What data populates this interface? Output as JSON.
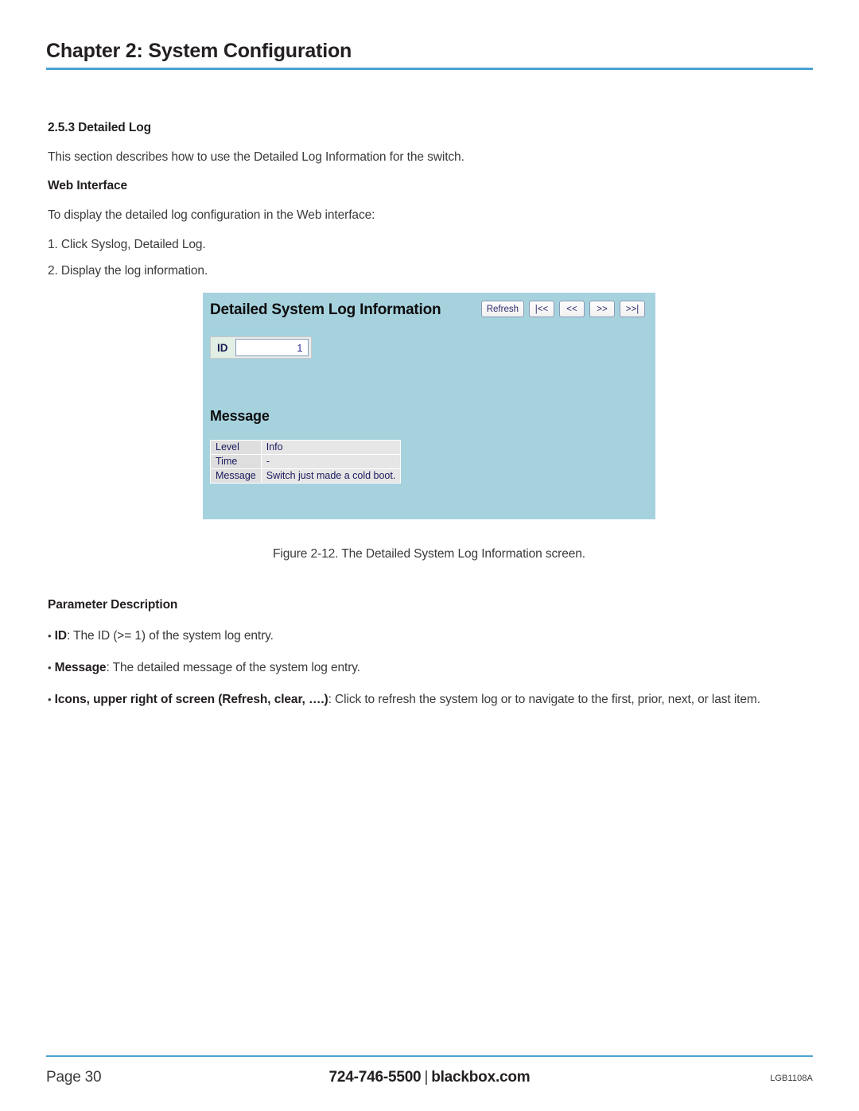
{
  "header": {
    "chapter_title": "Chapter 2: System Configuration",
    "rule_color": "#4ba3d3"
  },
  "body": {
    "section_number_title": "2.5.3 Detailed Log",
    "intro": "This section describes how to use the Detailed Log Information for the switch.",
    "web_interface_heading": "Web Interface",
    "web_interface_intro": "To display the detailed log configuration in the Web interface:",
    "step1": "1. Click Syslog, Detailed Log.",
    "step2": "2. Display the log information."
  },
  "figure": {
    "caption": "Figure 2-12. The Detailed System Log Information screen.",
    "panel_bg": "#a6d2de",
    "ui": {
      "title": "Detailed System Log Information",
      "buttons": [
        {
          "name": "refresh",
          "label": "Refresh"
        },
        {
          "name": "first",
          "label": "|<<"
        },
        {
          "name": "prev",
          "label": "<<"
        },
        {
          "name": "next",
          "label": ">>"
        },
        {
          "name": "last",
          "label": ">>|"
        }
      ],
      "id_label": "ID",
      "id_value": "1",
      "message_heading": "Message",
      "table": [
        {
          "key": "Level",
          "value": "Info"
        },
        {
          "key": "Time",
          "value": "-"
        },
        {
          "key": "Message",
          "value": "Switch just made a cold boot."
        }
      ]
    }
  },
  "params": {
    "heading": "Parameter Description",
    "bullets": [
      {
        "dot": "•",
        "label": "ID",
        "text": ": The ID (>= 1) of the system log entry."
      },
      {
        "dot": "•",
        "label": "Message",
        "text": ": The detailed message of the system log entry."
      },
      {
        "dot": "•",
        "label": "Icons, upper right of screen (Refresh, clear, ….)",
        "text": ": Click to refresh the system log or to navigate to the first, prior, next, or last item."
      }
    ]
  },
  "footer": {
    "page": "Page 30",
    "phone": "724-746-5500",
    "separator": "|",
    "site": "blackbox.com",
    "part_number": "LGB1108A"
  }
}
